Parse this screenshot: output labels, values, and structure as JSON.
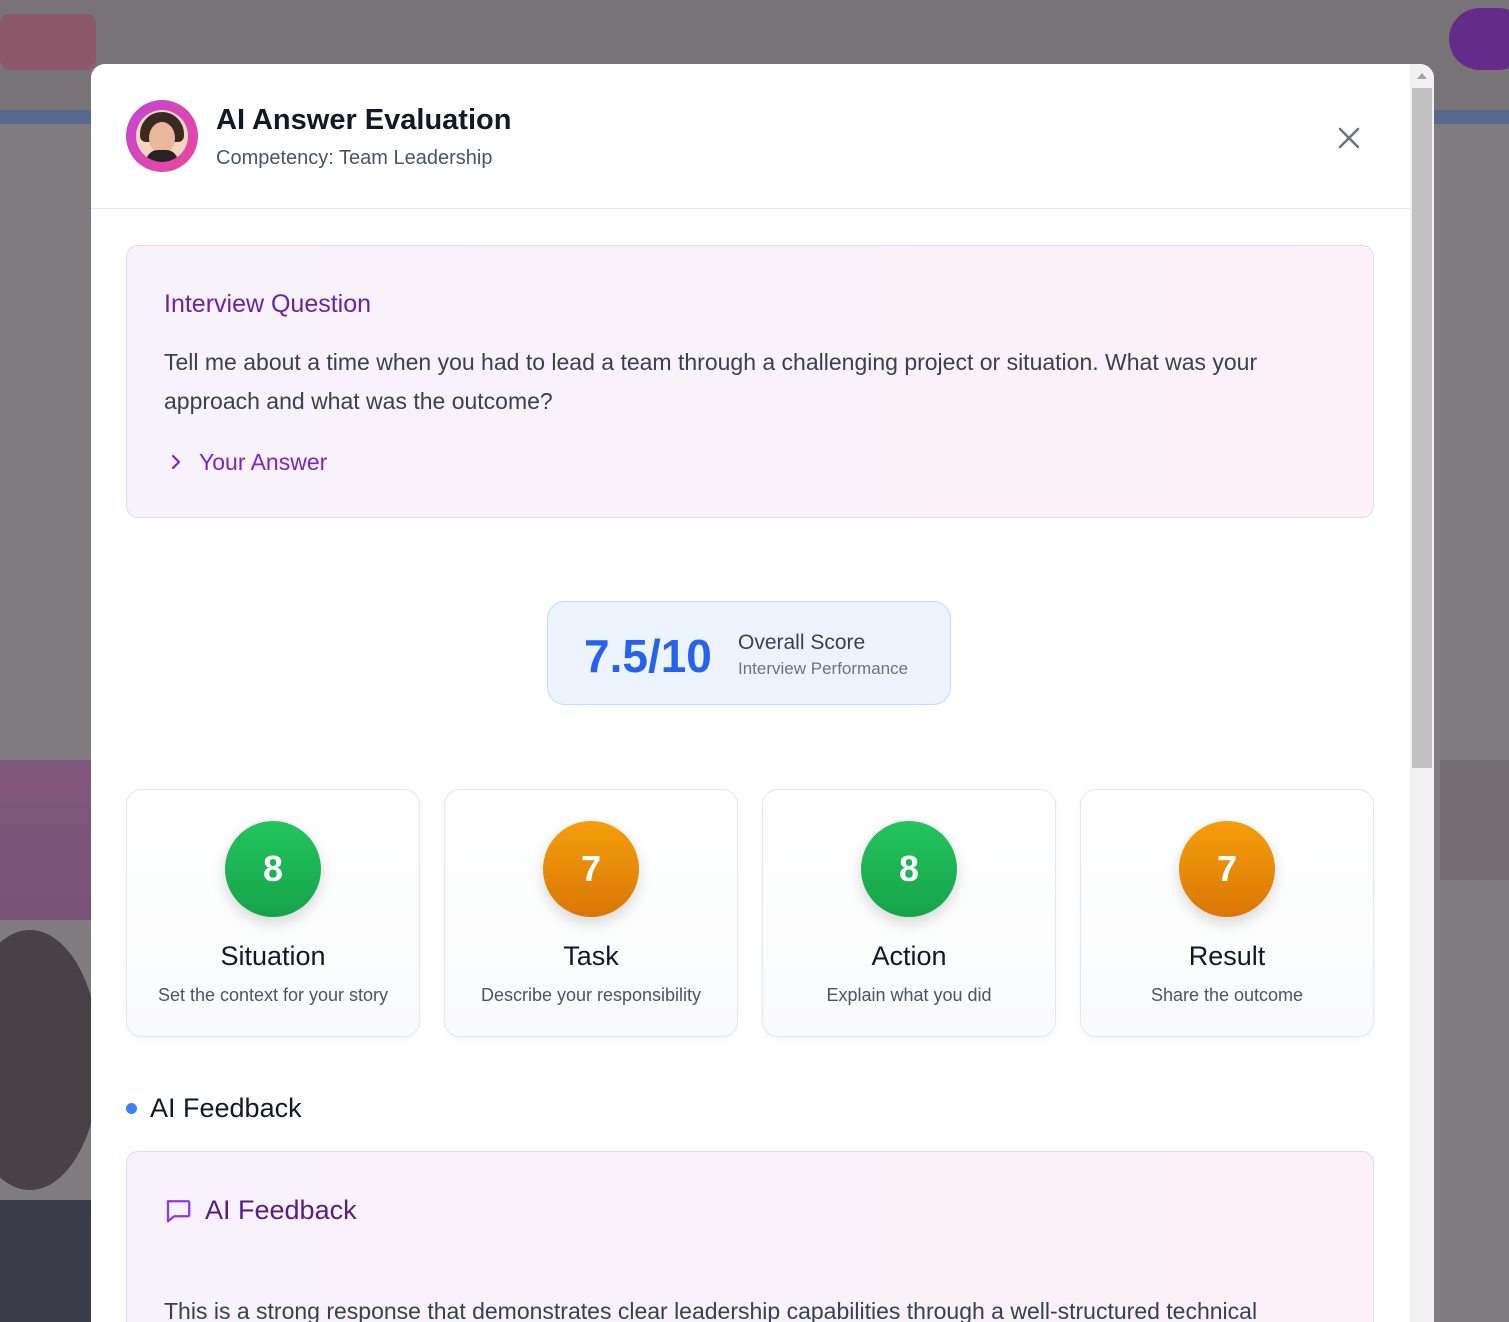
{
  "modal": {
    "title": "AI Answer Evaluation",
    "subtitle": "Competency: Team Leadership"
  },
  "question": {
    "label": "Interview Question",
    "text": "Tell me about a time when you had to lead a team through a challenging project or situation. What was your approach and what was the outcome?",
    "answer_toggle_label": "Your Answer"
  },
  "score": {
    "value": "7.5/10",
    "label": "Overall Score",
    "sublabel": "Interview Performance"
  },
  "star": [
    {
      "score": "8",
      "title": "Situation",
      "description": "Set the context for your story",
      "color": "#22c55e"
    },
    {
      "score": "7",
      "title": "Task",
      "description": "Describe your responsibility",
      "color": "#f59e0b"
    },
    {
      "score": "8",
      "title": "Action",
      "description": "Explain what you did",
      "color": "#22c55e"
    },
    {
      "score": "7",
      "title": "Result",
      "description": "Share the outcome",
      "color": "#f59e0b"
    }
  ],
  "feedback": {
    "section_title": "AI Feedback",
    "card_title": "AI Feedback",
    "text": "This is a strong response that demonstrates clear leadership capabilities through a well-structured technical"
  },
  "icons": {
    "close": "close-icon",
    "chevron": "chevron-right-icon",
    "message": "message-square-icon"
  }
}
